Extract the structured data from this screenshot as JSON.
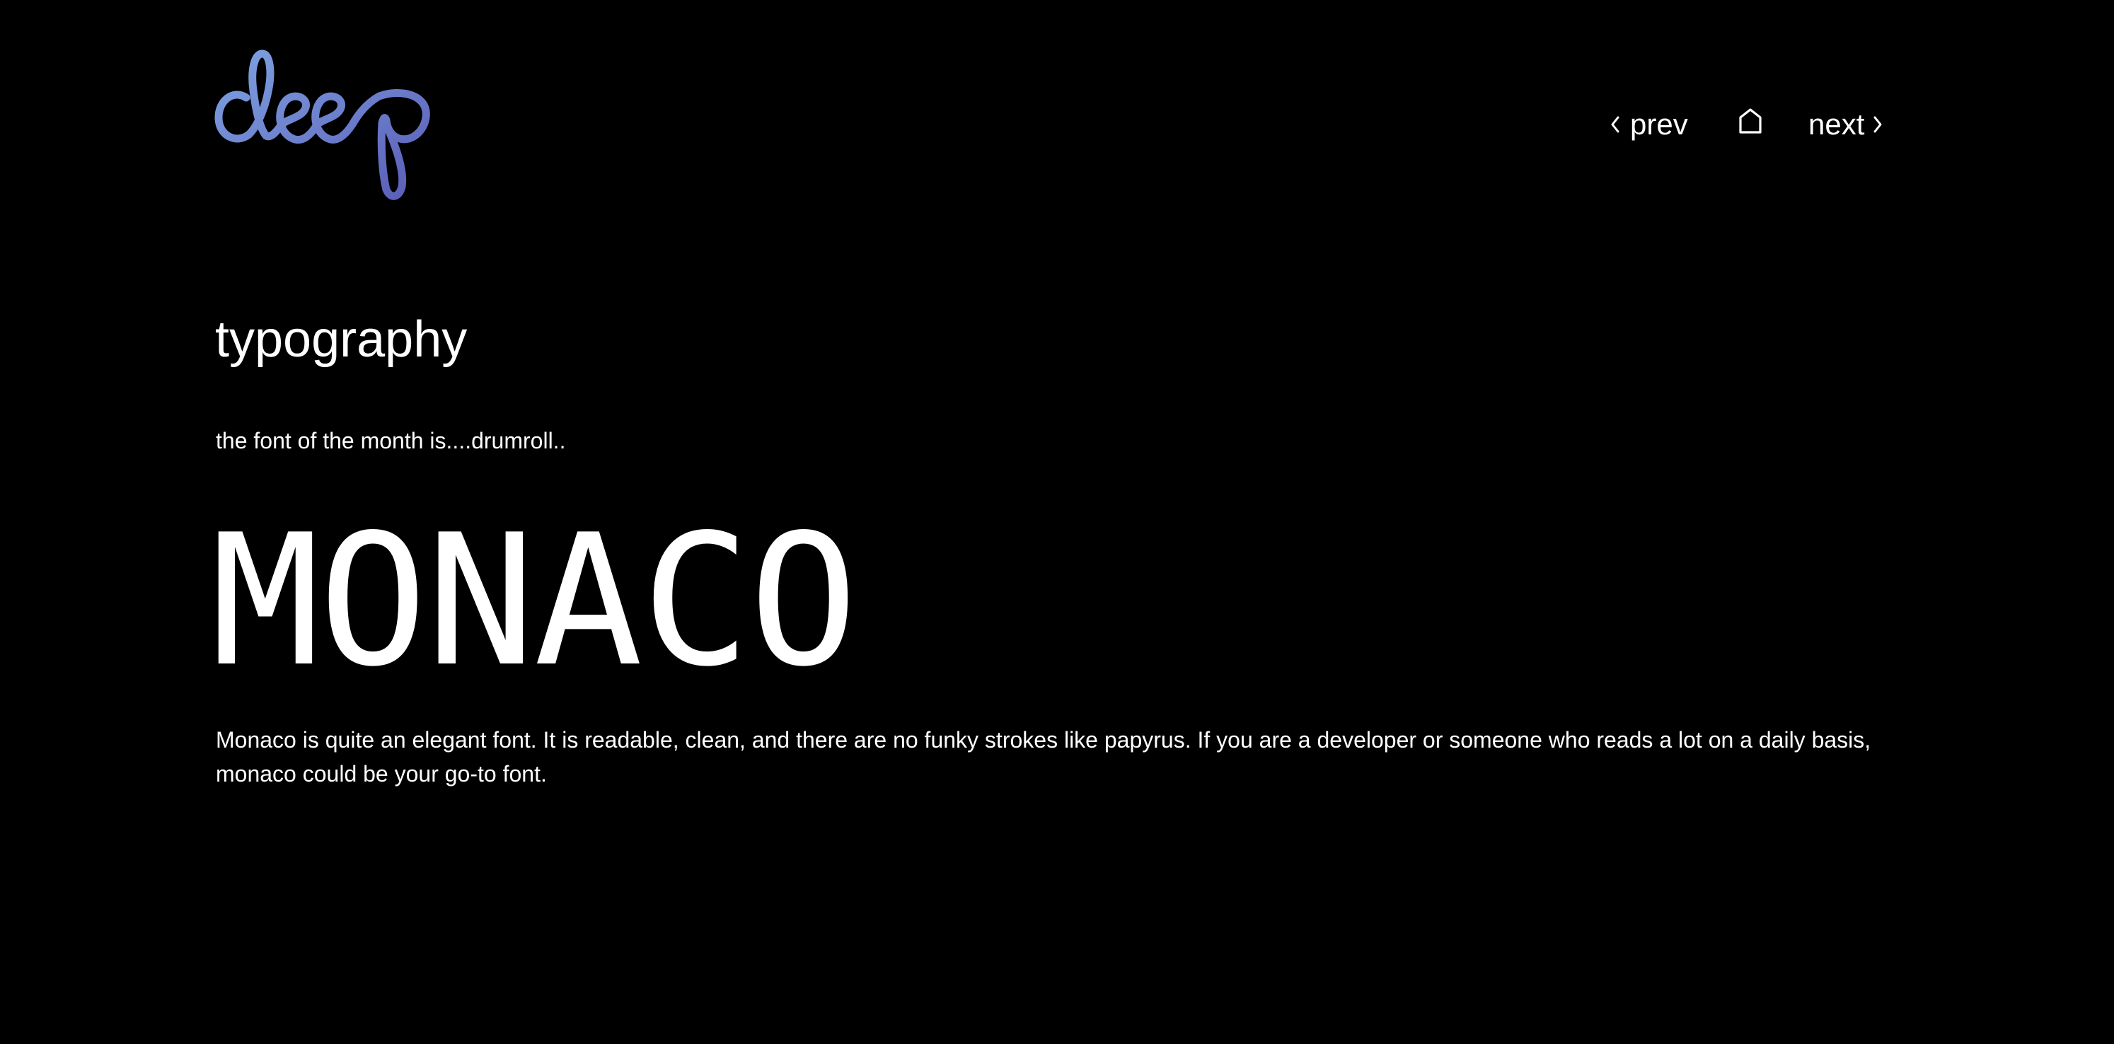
{
  "brand": {
    "logo_text": "deep",
    "gradient": [
      "#7a9ee0",
      "#5a5fb8"
    ]
  },
  "nav": {
    "prev_label": "prev",
    "home_icon": "home-icon",
    "next_label": "next",
    "prev_icon": "chevron-left-icon",
    "next_icon": "chevron-right-icon"
  },
  "page": {
    "title": "typography",
    "intro": "the font of the month is....drumroll..",
    "featured_font": "MONACO",
    "description": "Monaco is quite an elegant font. It is readable, clean, and there are no funky strokes like papyrus. If you are a developer or someone who reads a lot on a daily basis, monaco could be your go-to font."
  },
  "colors": {
    "background": "#000000",
    "text": "#ffffff"
  }
}
